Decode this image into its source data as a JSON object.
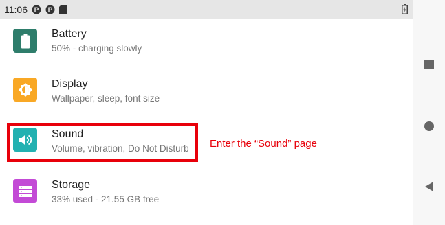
{
  "status_bar": {
    "time": "11:06",
    "icons": [
      "p-badge-icon",
      "p-badge-icon",
      "sd-card-icon"
    ],
    "battery_icon": "battery-charging-icon"
  },
  "settings": [
    {
      "id": "battery",
      "title": "Battery",
      "summary": "50% - charging slowly",
      "icon": "battery-icon",
      "color": "#2e7d6b"
    },
    {
      "id": "display",
      "title": "Display",
      "summary": "Wallpaper, sleep, font size",
      "icon": "brightness-icon",
      "color": "#f9a825"
    },
    {
      "id": "sound",
      "title": "Sound",
      "summary": "Volume, vibration, Do Not Disturb",
      "icon": "volume-icon",
      "color": "#22b1b1"
    },
    {
      "id": "storage",
      "title": "Storage",
      "summary": "33% used - 21.55 GB free",
      "icon": "storage-icon",
      "color": "#c34ad6"
    }
  ],
  "annotation": {
    "text": "Enter the “Sound” page",
    "color": "#e8000a"
  },
  "nav_bar": {
    "buttons": [
      "recents-icon",
      "home-icon",
      "back-icon"
    ]
  }
}
